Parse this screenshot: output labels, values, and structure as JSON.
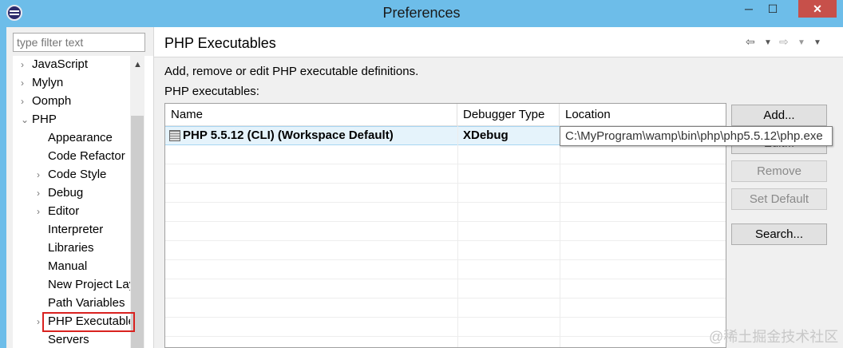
{
  "window": {
    "title": "Preferences",
    "minimize_glyph": "─",
    "maximize_glyph": "☐",
    "close_glyph": "✕"
  },
  "sidebar": {
    "filter_placeholder": "type filter text",
    "items": [
      {
        "label": "JavaScript",
        "level": 0,
        "twisty": "›"
      },
      {
        "label": "Mylyn",
        "level": 0,
        "twisty": "›"
      },
      {
        "label": "Oomph",
        "level": 0,
        "twisty": "›"
      },
      {
        "label": "PHP",
        "level": 0,
        "twisty": "⌄"
      },
      {
        "label": "Appearance",
        "level": 1,
        "twisty": ""
      },
      {
        "label": "Code Refactor",
        "level": 1,
        "twisty": ""
      },
      {
        "label": "Code Style",
        "level": 1,
        "twisty": "›"
      },
      {
        "label": "Debug",
        "level": 1,
        "twisty": "›"
      },
      {
        "label": "Editor",
        "level": 1,
        "twisty": "›"
      },
      {
        "label": "Interpreter",
        "level": 1,
        "twisty": ""
      },
      {
        "label": "Libraries",
        "level": 1,
        "twisty": ""
      },
      {
        "label": "Manual",
        "level": 1,
        "twisty": ""
      },
      {
        "label": "New Project Lay",
        "level": 1,
        "twisty": ""
      },
      {
        "label": "Path Variables",
        "level": 1,
        "twisty": ""
      },
      {
        "label": "PHP Executable",
        "level": 1,
        "twisty": "›",
        "selected": true
      },
      {
        "label": "Servers",
        "level": 1,
        "twisty": ""
      }
    ]
  },
  "panel": {
    "title": "PHP Executables",
    "description": "Add, remove or edit PHP executable definitions.",
    "list_label": "PHP executables:",
    "nav": {
      "back": "⇦",
      "back_menu": "▼",
      "forward": "⇨",
      "forward_menu": "▼",
      "view_menu": "▼"
    }
  },
  "table": {
    "columns": [
      "Name",
      "Debugger Type",
      "Location"
    ],
    "rows": [
      {
        "name": "PHP 5.5.12 (CLI) (Workspace Default)",
        "debugger": "XDebug"
      }
    ],
    "tooltip": "C:\\MyProgram\\wamp\\bin\\php\\php5.5.12\\php.exe"
  },
  "buttons": {
    "add": "Add...",
    "edit": "Edit...",
    "remove": "Remove",
    "set_default": "Set Default",
    "search": "Search..."
  },
  "watermark": "@稀土掘金技术社区"
}
